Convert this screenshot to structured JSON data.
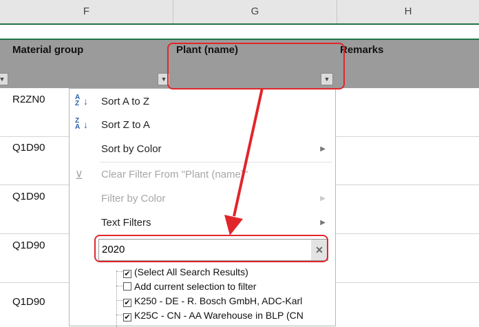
{
  "columns": [
    "F",
    "G",
    "H"
  ],
  "header": {
    "material_group": "Material group",
    "plant_name": "Plant (name)",
    "remarks": "Remarks"
  },
  "rows": [
    "R2ZN0",
    "Q1D90",
    "Q1D90",
    "Q1D90",
    "Q1D90"
  ],
  "menu": {
    "sort_a_z": "Sort A to Z",
    "sort_z_a": "Sort Z to A",
    "sort_by_color": "Sort by Color",
    "clear_filter": "Clear Filter From \"Plant (name)\"",
    "filter_by_color": "Filter by Color",
    "text_filters": "Text Filters"
  },
  "search": {
    "value": "2020"
  },
  "list": [
    {
      "label": "(Select All Search Results)",
      "checked": true
    },
    {
      "label": "Add current selection to filter",
      "checked": false
    },
    {
      "label": "K250 - DE - R. Bosch GmbH, ADC-Karl",
      "checked": true
    },
    {
      "label": "K25C - CN - AA Warehouse in BLP (CN",
      "checked": true
    }
  ],
  "colors": {
    "highlight": "#e0262b",
    "header_bg": "#9b9b9b",
    "excel_green": "#217346"
  }
}
